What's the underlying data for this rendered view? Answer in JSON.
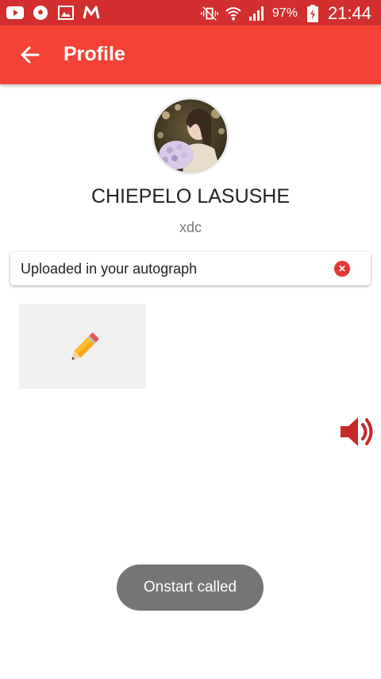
{
  "status_bar": {
    "battery_percent": "97%",
    "time": "21:44",
    "left_icons": [
      "youtube-icon",
      "soccer-ball-icon",
      "image-icon",
      "m-logo-icon"
    ],
    "right_icons": [
      "vibrate-mute-icon",
      "wifi-icon",
      "signal-icon",
      "battery-charging-icon"
    ]
  },
  "app_bar": {
    "title": "Profile",
    "back_icon": "arrow-back-icon",
    "color": "#f44336"
  },
  "profile": {
    "name": "CHIEPELO LASUSHE",
    "username": "xdc"
  },
  "autograph_field": {
    "value": "Uploaded in your autograph",
    "clear_icon": "clear-circle-icon",
    "clear_symbol": "✕"
  },
  "signature": {
    "icon": "pencil-icon"
  },
  "speaker": {
    "icon": "speaker-volume-icon",
    "color": "#c62828"
  },
  "toast": {
    "message": "Onstart called"
  }
}
